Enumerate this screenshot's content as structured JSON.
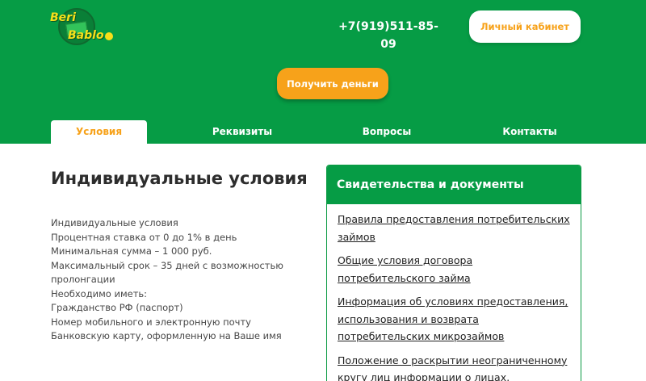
{
  "logo": {
    "line1": "Beri",
    "line2": "Bablo"
  },
  "header": {
    "phone": "+7(919)511-85-09",
    "cabinet_label": "Личный кабинет",
    "get_money_label": "Получить деньги"
  },
  "tabs": [
    {
      "label": "Условия",
      "active": true
    },
    {
      "label": "Реквизиты",
      "active": false
    },
    {
      "label": "Вопросы",
      "active": false
    },
    {
      "label": "Контакты",
      "active": false
    }
  ],
  "main": {
    "title": "Индивидуальные условия",
    "conditions": [
      "Индивидуальные условия",
      "Процентная ставка от 0 до 1% в день",
      "Минимальная сумма – 1 000 руб.",
      "Максимальный срок – 35 дней с возможностью пролонгации",
      "Необходимо иметь:",
      "Гражданство РФ (паспорт)",
      "Номер мобильного и электронную почту",
      "Банковскую карту, оформленную на Ваше имя"
    ]
  },
  "docs": {
    "title": "Свидетельства и документы",
    "items": [
      "Правила предоставления потребительских займов",
      "Общие условия договора потребительского займа",
      "Информация об условиях предоставления, использования и возврата потребительских микрозаймов",
      "Положение о раскрытии неограниченному кругу лиц информации о лицах,"
    ]
  },
  "colors": {
    "green": "#069c45",
    "orange": "#f7a21a",
    "logo_yellow": "#f6df1a"
  }
}
